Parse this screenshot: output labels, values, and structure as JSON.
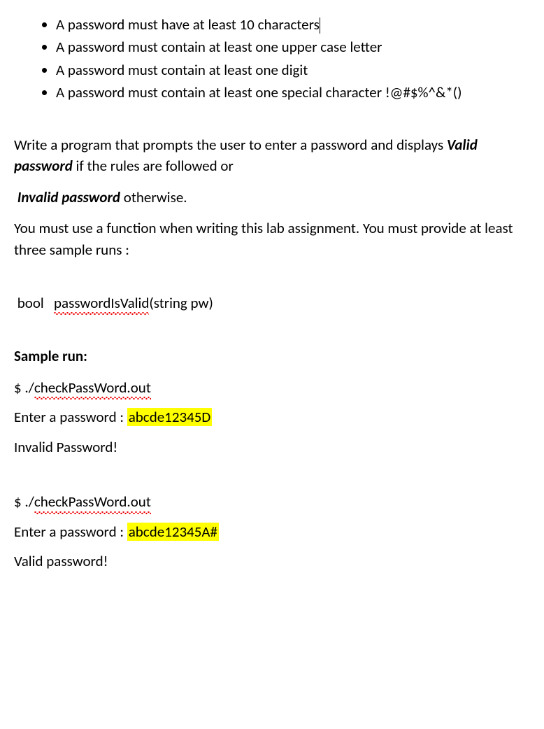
{
  "rules": {
    "items": [
      "A password must have at least 10 characters",
      "A password must contain at least one upper case letter",
      "A password must contain at least one digit",
      "A password must contain at least one special character !@#$%^&*()"
    ]
  },
  "instructions": {
    "part1_pre": "Write a program that prompts the user to enter a password and displays ",
    "valid_label": "Valid password",
    "part1_post": " if the rules are followed or",
    "invalid_label": "Invalid password",
    "part2_post": " otherwise.",
    "func_req": "You must use a function when writing this lab assignment. You must provide at least three sample runs :"
  },
  "fn": {
    "ret": "bool",
    "name": "passwordIsValid",
    "sig_rest": "(string   pw)"
  },
  "sample": {
    "heading": "Sample run:",
    "runs": [
      {
        "cmd_prefix": "$   ./",
        "exe": "checkPassWord.out",
        "prompt_label": "Enter a password  :  ",
        "input": "abcde12345D",
        "result": "Invalid Password!"
      },
      {
        "cmd_prefix": "$  ./",
        "exe": "checkPassWord.out",
        "prompt_label": "Enter a password  :   ",
        "input": "abcde12345A#",
        "result": "Valid password!"
      }
    ]
  }
}
